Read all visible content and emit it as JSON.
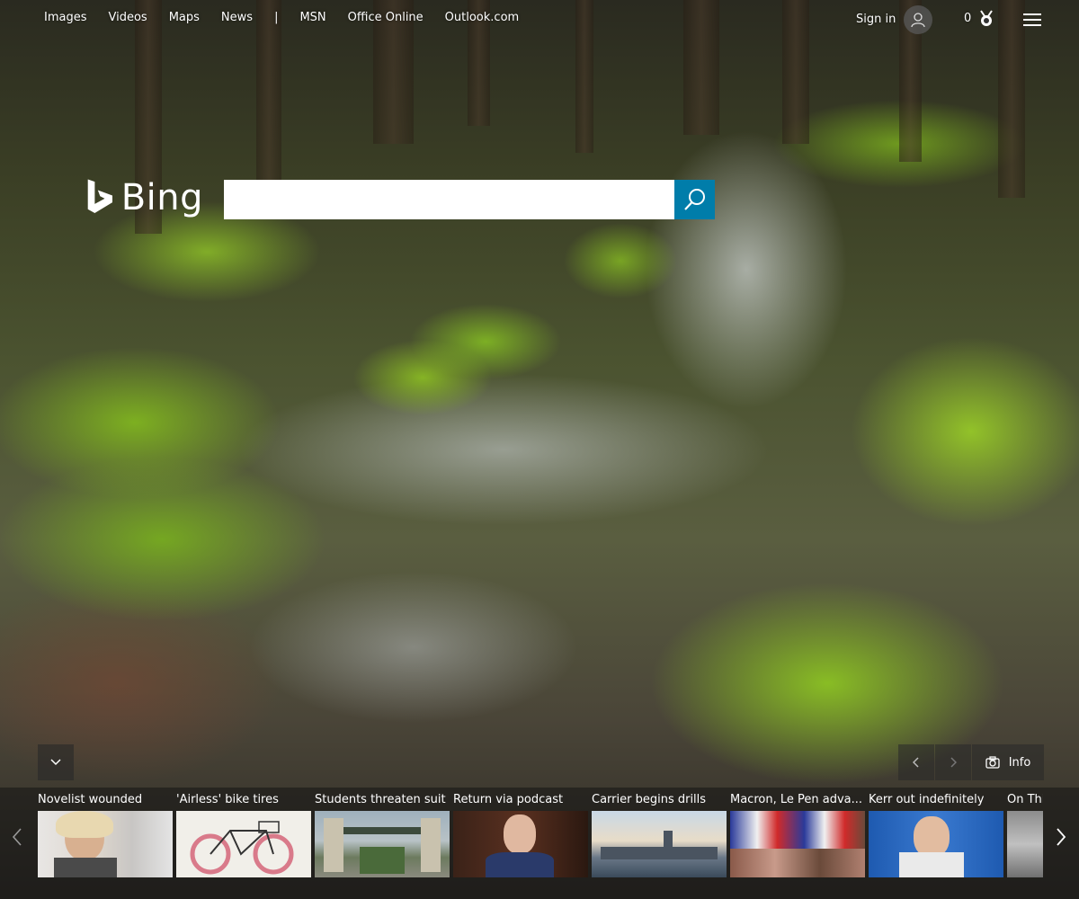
{
  "nav": {
    "links": [
      "Images",
      "Videos",
      "Maps",
      "News"
    ],
    "separator": "|",
    "links2": [
      "MSN",
      "Office Online",
      "Outlook.com"
    ]
  },
  "account": {
    "signin_label": "Sign in",
    "rewards_count": "0"
  },
  "logo": {
    "text": "Bing"
  },
  "search": {
    "value": "",
    "placeholder": ""
  },
  "image_controls": {
    "info_label": "Info"
  },
  "news": [
    {
      "title": "Novelist wounded",
      "thumb": "woman-portrait"
    },
    {
      "title": "'Airless' bike tires",
      "thumb": "bicycle"
    },
    {
      "title": "Students threaten suit",
      "thumb": "campus-gate"
    },
    {
      "title": "Return via podcast",
      "thumb": "man-portrait"
    },
    {
      "title": "Carrier begins drills",
      "thumb": "aircraft-carrier"
    },
    {
      "title": "Macron, Le Pen adva...",
      "thumb": "crowd-flags"
    },
    {
      "title": "Kerr out indefinitely",
      "thumb": "press-conference"
    },
    {
      "title": "On Thi",
      "thumb": "historic-photo"
    }
  ],
  "colors": {
    "search_button": "#007daa",
    "text": "#ffffff"
  }
}
